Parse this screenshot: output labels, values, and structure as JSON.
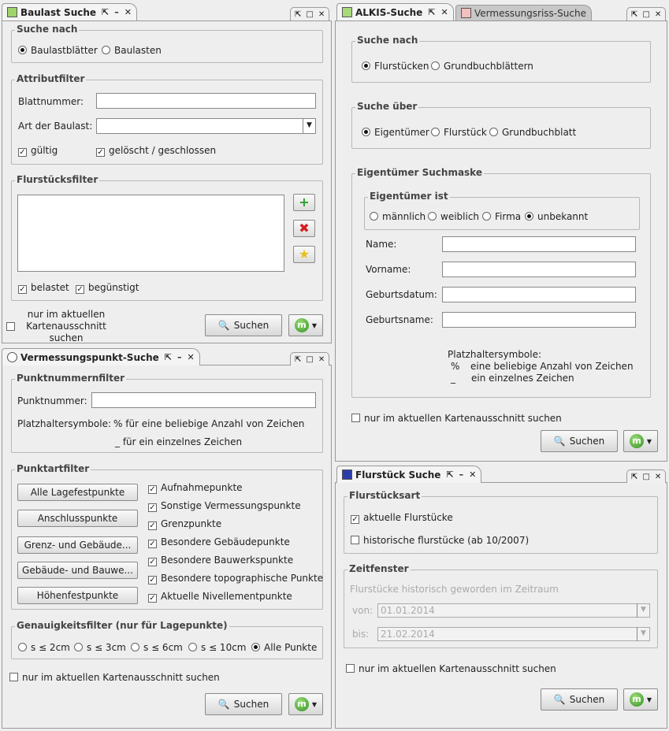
{
  "baulast": {
    "tab_title": "Baulast Suche",
    "suche_nach": {
      "title": "Suche nach",
      "options": [
        "Baulastblätter",
        "Baulasten"
      ],
      "selected": 0
    },
    "attributfilter": {
      "title": "Attributfilter",
      "blatt_label": "Blattnummer:",
      "art_label": "Art der Baulast:",
      "gueltig": "gültig",
      "geloescht": "gelöscht / geschlossen"
    },
    "flurstuecksfilter": {
      "title": "Flurstücksfilter",
      "belastet": "belastet",
      "beguenstigt": "begünstigt"
    },
    "map_only": "nur im aktuellen Kartenausschnitt suchen",
    "map_only_lines": [
      "nur im aktuellen",
      "Kartenausschnitt",
      "suchen"
    ],
    "search": "Suchen"
  },
  "vermessung": {
    "tab_title": "Vermessungspunkt-Suche",
    "punktnummern": {
      "title": "Punktnummernfilter",
      "label": "Punktnummer:",
      "platz_label": "Platzhaltersymbole:",
      "platz1": "% für eine beliebige Anzahl von Zeichen",
      "platz2": "_ für ein einzelnes Zeichen"
    },
    "punktart": {
      "title": "Punktartfilter",
      "buttons": [
        "Alle Lagefestpunkte",
        "Anschlusspunkte",
        "Grenz- und Gebäude...",
        "Gebäude- und Bauwe...",
        "Höhenfestpunkte"
      ],
      "checks": [
        "Aufnahmepunkte",
        "Sonstige Vermessungspunkte",
        "Grenzpunkte",
        "Besondere Gebäudepunkte",
        "Besondere Bauwerkspunkte",
        "Besondere topographische Punkte",
        "Aktuelle Nivellementpunkte"
      ]
    },
    "genauigkeit": {
      "title": "Genauigkeitsfilter (nur für Lagepunkte)",
      "options": [
        "s ≤ 2cm",
        "s ≤ 3cm",
        "s ≤ 6cm",
        "s ≤ 10cm",
        "Alle Punkte"
      ],
      "selected": 4
    },
    "map_only": "nur im aktuellen Kartenausschnitt suchen",
    "search": "Suchen"
  },
  "alkis": {
    "tab_title": "ALKIS-Suche",
    "tab2_title": "Vermessungsriss-Suche",
    "suche_nach": {
      "title": "Suche nach",
      "options": [
        "Flurstücken",
        "Grundbuchblättern"
      ],
      "selected": 0
    },
    "suche_ueber": {
      "title": "Suche über",
      "options": [
        "Eigentümer",
        "Flurstück",
        "Grundbuchblatt"
      ],
      "selected": 0
    },
    "maske": {
      "title": "Eigentümer Suchmaske",
      "ist_title": "Eigentümer ist",
      "ist_options": [
        "männlich",
        "weiblich",
        "Firma",
        "unbekannt"
      ],
      "ist_selected": 3,
      "fields": [
        "Name:",
        "Vorname:",
        "Geburtsdatum:",
        "Geburtsname:"
      ],
      "platz_title": "Platzhaltersymbole:",
      "platz1_sym": "%",
      "platz1": "eine beliebige Anzahl von Zeichen",
      "platz2_sym": "_",
      "platz2": "ein einzelnes Zeichen"
    },
    "map_only": "nur im aktuellen Kartenausschnitt suchen",
    "search": "Suchen"
  },
  "flurstueck": {
    "tab_title": "Flurstück Suche",
    "art": {
      "title": "Flurstücksart",
      "aktuelle": "aktuelle Flurstücke",
      "historische": "historische flurstücke (ab 10/2007)"
    },
    "zeit": {
      "title": "Zeitfenster",
      "desc": "Flurstücke historisch geworden im Zeitraum",
      "von_label": "von:",
      "von": "01.01.2014",
      "bis_label": "bis:",
      "bis": "21.02.2014"
    },
    "map_only": "nur im aktuellen Kartenausschnitt suchen",
    "search": "Suchen"
  },
  "colors": {
    "accent": "#2f8f22",
    "add": "#2aa02a",
    "remove": "#d42020"
  }
}
